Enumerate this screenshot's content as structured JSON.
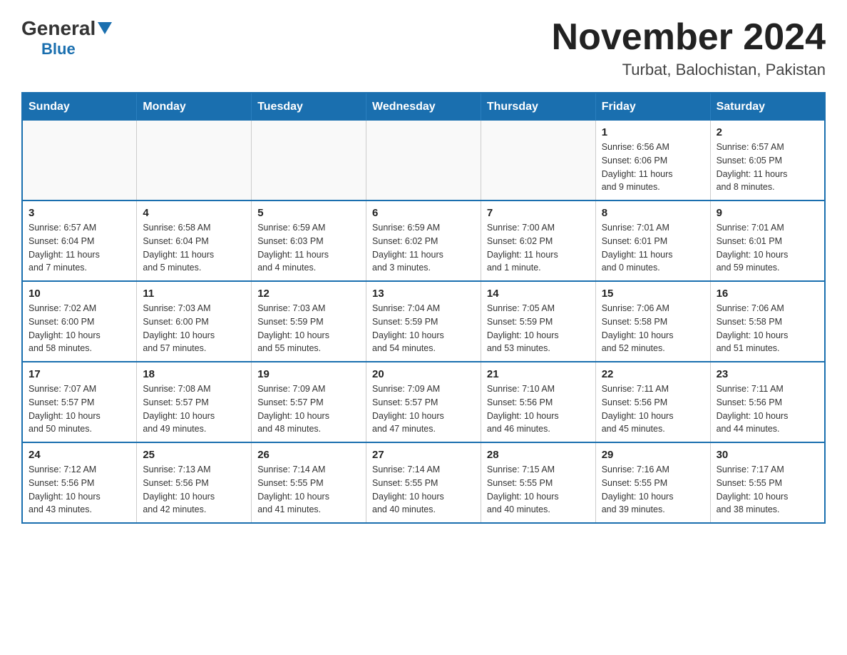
{
  "header": {
    "logo_general": "General",
    "logo_blue": "Blue",
    "month_title": "November 2024",
    "location": "Turbat, Balochistan, Pakistan"
  },
  "weekdays": [
    "Sunday",
    "Monday",
    "Tuesday",
    "Wednesday",
    "Thursday",
    "Friday",
    "Saturday"
  ],
  "weeks": [
    [
      {
        "day": "",
        "info": ""
      },
      {
        "day": "",
        "info": ""
      },
      {
        "day": "",
        "info": ""
      },
      {
        "day": "",
        "info": ""
      },
      {
        "day": "",
        "info": ""
      },
      {
        "day": "1",
        "info": "Sunrise: 6:56 AM\nSunset: 6:06 PM\nDaylight: 11 hours\nand 9 minutes."
      },
      {
        "day": "2",
        "info": "Sunrise: 6:57 AM\nSunset: 6:05 PM\nDaylight: 11 hours\nand 8 minutes."
      }
    ],
    [
      {
        "day": "3",
        "info": "Sunrise: 6:57 AM\nSunset: 6:04 PM\nDaylight: 11 hours\nand 7 minutes."
      },
      {
        "day": "4",
        "info": "Sunrise: 6:58 AM\nSunset: 6:04 PM\nDaylight: 11 hours\nand 5 minutes."
      },
      {
        "day": "5",
        "info": "Sunrise: 6:59 AM\nSunset: 6:03 PM\nDaylight: 11 hours\nand 4 minutes."
      },
      {
        "day": "6",
        "info": "Sunrise: 6:59 AM\nSunset: 6:02 PM\nDaylight: 11 hours\nand 3 minutes."
      },
      {
        "day": "7",
        "info": "Sunrise: 7:00 AM\nSunset: 6:02 PM\nDaylight: 11 hours\nand 1 minute."
      },
      {
        "day": "8",
        "info": "Sunrise: 7:01 AM\nSunset: 6:01 PM\nDaylight: 11 hours\nand 0 minutes."
      },
      {
        "day": "9",
        "info": "Sunrise: 7:01 AM\nSunset: 6:01 PM\nDaylight: 10 hours\nand 59 minutes."
      }
    ],
    [
      {
        "day": "10",
        "info": "Sunrise: 7:02 AM\nSunset: 6:00 PM\nDaylight: 10 hours\nand 58 minutes."
      },
      {
        "day": "11",
        "info": "Sunrise: 7:03 AM\nSunset: 6:00 PM\nDaylight: 10 hours\nand 57 minutes."
      },
      {
        "day": "12",
        "info": "Sunrise: 7:03 AM\nSunset: 5:59 PM\nDaylight: 10 hours\nand 55 minutes."
      },
      {
        "day": "13",
        "info": "Sunrise: 7:04 AM\nSunset: 5:59 PM\nDaylight: 10 hours\nand 54 minutes."
      },
      {
        "day": "14",
        "info": "Sunrise: 7:05 AM\nSunset: 5:59 PM\nDaylight: 10 hours\nand 53 minutes."
      },
      {
        "day": "15",
        "info": "Sunrise: 7:06 AM\nSunset: 5:58 PM\nDaylight: 10 hours\nand 52 minutes."
      },
      {
        "day": "16",
        "info": "Sunrise: 7:06 AM\nSunset: 5:58 PM\nDaylight: 10 hours\nand 51 minutes."
      }
    ],
    [
      {
        "day": "17",
        "info": "Sunrise: 7:07 AM\nSunset: 5:57 PM\nDaylight: 10 hours\nand 50 minutes."
      },
      {
        "day": "18",
        "info": "Sunrise: 7:08 AM\nSunset: 5:57 PM\nDaylight: 10 hours\nand 49 minutes."
      },
      {
        "day": "19",
        "info": "Sunrise: 7:09 AM\nSunset: 5:57 PM\nDaylight: 10 hours\nand 48 minutes."
      },
      {
        "day": "20",
        "info": "Sunrise: 7:09 AM\nSunset: 5:57 PM\nDaylight: 10 hours\nand 47 minutes."
      },
      {
        "day": "21",
        "info": "Sunrise: 7:10 AM\nSunset: 5:56 PM\nDaylight: 10 hours\nand 46 minutes."
      },
      {
        "day": "22",
        "info": "Sunrise: 7:11 AM\nSunset: 5:56 PM\nDaylight: 10 hours\nand 45 minutes."
      },
      {
        "day": "23",
        "info": "Sunrise: 7:11 AM\nSunset: 5:56 PM\nDaylight: 10 hours\nand 44 minutes."
      }
    ],
    [
      {
        "day": "24",
        "info": "Sunrise: 7:12 AM\nSunset: 5:56 PM\nDaylight: 10 hours\nand 43 minutes."
      },
      {
        "day": "25",
        "info": "Sunrise: 7:13 AM\nSunset: 5:56 PM\nDaylight: 10 hours\nand 42 minutes."
      },
      {
        "day": "26",
        "info": "Sunrise: 7:14 AM\nSunset: 5:55 PM\nDaylight: 10 hours\nand 41 minutes."
      },
      {
        "day": "27",
        "info": "Sunrise: 7:14 AM\nSunset: 5:55 PM\nDaylight: 10 hours\nand 40 minutes."
      },
      {
        "day": "28",
        "info": "Sunrise: 7:15 AM\nSunset: 5:55 PM\nDaylight: 10 hours\nand 40 minutes."
      },
      {
        "day": "29",
        "info": "Sunrise: 7:16 AM\nSunset: 5:55 PM\nDaylight: 10 hours\nand 39 minutes."
      },
      {
        "day": "30",
        "info": "Sunrise: 7:17 AM\nSunset: 5:55 PM\nDaylight: 10 hours\nand 38 minutes."
      }
    ]
  ]
}
